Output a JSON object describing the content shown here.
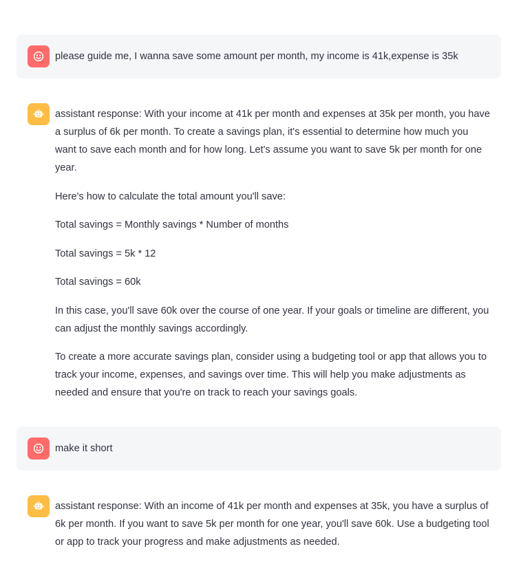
{
  "colors": {
    "user_avatar": "#ff6b6b",
    "assistant_avatar": "#ffbd45",
    "user_bubble": "#f5f6f8",
    "text": "#31333f"
  },
  "messages": [
    {
      "role": "user",
      "icon": "smiley-face-icon",
      "paragraphs": [
        "please guide me, I wanna save some amount per month, my income is 41k,expense is 35k"
      ]
    },
    {
      "role": "assistant",
      "icon": "robot-icon",
      "paragraphs": [
        "assistant response: With your income at 41k per month and expenses at 35k per month, you have a surplus of 6k per month. To create a savings plan, it's essential to determine how much you want to save each month and for how long. Let's assume you want to save 5k per month for one year.",
        "Here's how to calculate the total amount you'll save:",
        "Total savings = Monthly savings * Number of months",
        "Total savings = 5k * 12",
        "Total savings = 60k",
        "In this case, you'll save 60k over the course of one year. If your goals or timeline are different, you can adjust the monthly savings accordingly.",
        "To create a more accurate savings plan, consider using a budgeting tool or app that allows you to track your income, expenses, and savings over time. This will help you make adjustments as needed and ensure that you're on track to reach your savings goals."
      ]
    },
    {
      "role": "user",
      "icon": "smiley-face-icon",
      "paragraphs": [
        "make it short"
      ]
    },
    {
      "role": "assistant",
      "icon": "robot-icon",
      "paragraphs": [
        "assistant response: With an income of 41k per month and expenses at 35k, you have a surplus of 6k per month. If you want to save 5k per month for one year, you'll save 60k. Use a budgeting tool or app to track your progress and make adjustments as needed."
      ]
    }
  ]
}
